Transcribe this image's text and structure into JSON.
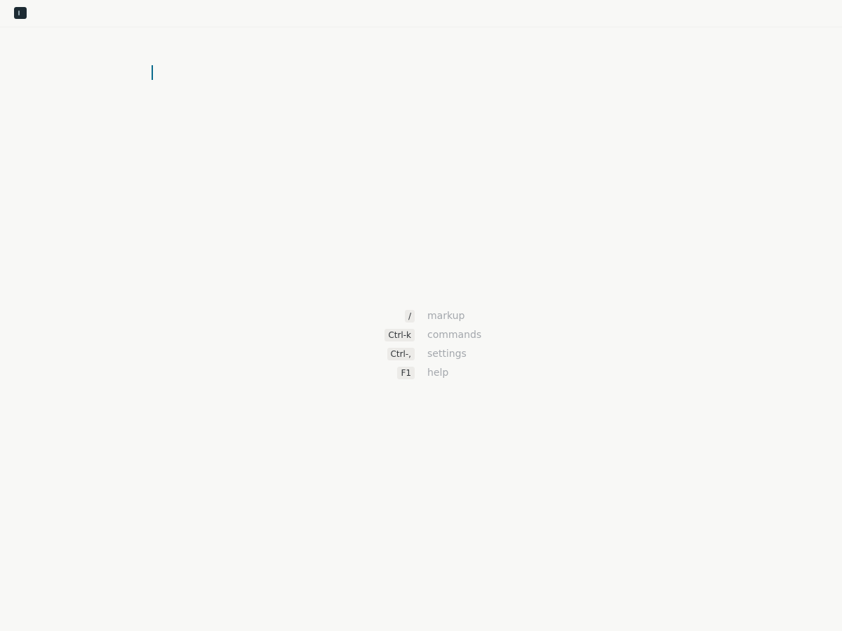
{
  "colors": {
    "background": "#f8f8f6",
    "caret": "#0b6b8d",
    "key_background": "#ecebe8",
    "description_text": "#a4a8ad",
    "app_icon": "#1d2b33"
  },
  "header": {
    "icon": "app-logo-icon"
  },
  "shortcuts": [
    {
      "key": "/",
      "label": "markup"
    },
    {
      "key": "Ctrl-k",
      "label": "commands"
    },
    {
      "key": "Ctrl-,",
      "label": "settings"
    },
    {
      "key": "F1",
      "label": "help"
    }
  ]
}
